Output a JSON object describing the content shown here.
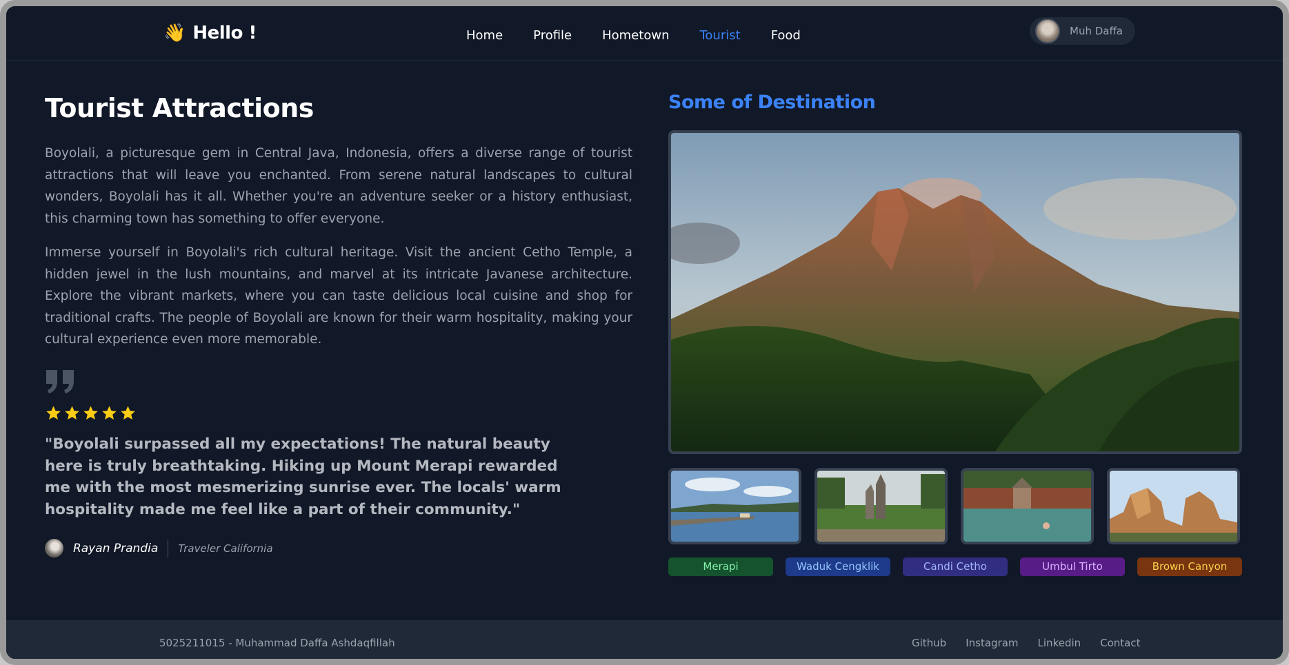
{
  "navbar": {
    "brand": "Hello !",
    "brand_icon": "waving-hand-icon",
    "links": [
      "Home",
      "Profile",
      "Hometown",
      "Tourist",
      "Food"
    ],
    "active_link": "Tourist",
    "user_name": "Muh Daffa"
  },
  "main": {
    "title": "Tourist Attractions",
    "paragraph_1": "Boyolali, a picturesque gem in Central Java, Indonesia, offers a diverse range of tourist attractions that will leave you enchanted. From serene natural landscapes to cultural wonders, Boyolali has it all. Whether you're an adventure seeker or a history enthusiast, this charming town has something to offer everyone.",
    "paragraph_2": "Immerse yourself in Boyolali's rich cultural heritage. Visit the ancient Cetho Temple, a hidden jewel in the lush mountains, and marvel at its intricate Javanese architecture. Explore the vibrant markets, where you can taste delicious local cuisine and shop for traditional crafts. The people of Boyolali are known for their warm hospitality, making your cultural experience even more memorable.",
    "testimonial": {
      "rating": 5,
      "rating_max": 5,
      "quote": "\"Boyolali surpassed all my expectations! The natural beauty here is truly breathtaking. Hiking up Mount Merapi rewarded me with the most mesmerizing sunrise ever. The locals' warm hospitality made me feel like a part of their community.\"",
      "author": "Rayan Prandia",
      "role": "Traveler California"
    }
  },
  "gallery": {
    "title": "Some of Destination",
    "tags": [
      {
        "label": "Merapi",
        "bg": "#14532d",
        "color": "#86efac"
      },
      {
        "label": "Waduk Cengklik",
        "bg": "#1e3a8a",
        "color": "#93c5fd"
      },
      {
        "label": "Candi Cetho",
        "bg": "#312e81",
        "color": "#a5b4fc"
      },
      {
        "label": "Umbul Tirto",
        "bg": "#581c87",
        "color": "#d8b4fe"
      },
      {
        "label": "Brown Canyon",
        "bg": "#78350f",
        "color": "#fcd34d"
      }
    ]
  },
  "footer": {
    "copyright": "5025211015 - Muhammad Daffa Ashdaqfillah",
    "links": [
      "Github",
      "Instagram",
      "Linkedin",
      "Contact"
    ]
  },
  "colors": {
    "background": "#111827",
    "accent": "#3b82f6",
    "footer_bg": "#1f2937",
    "star": "#facc15"
  }
}
